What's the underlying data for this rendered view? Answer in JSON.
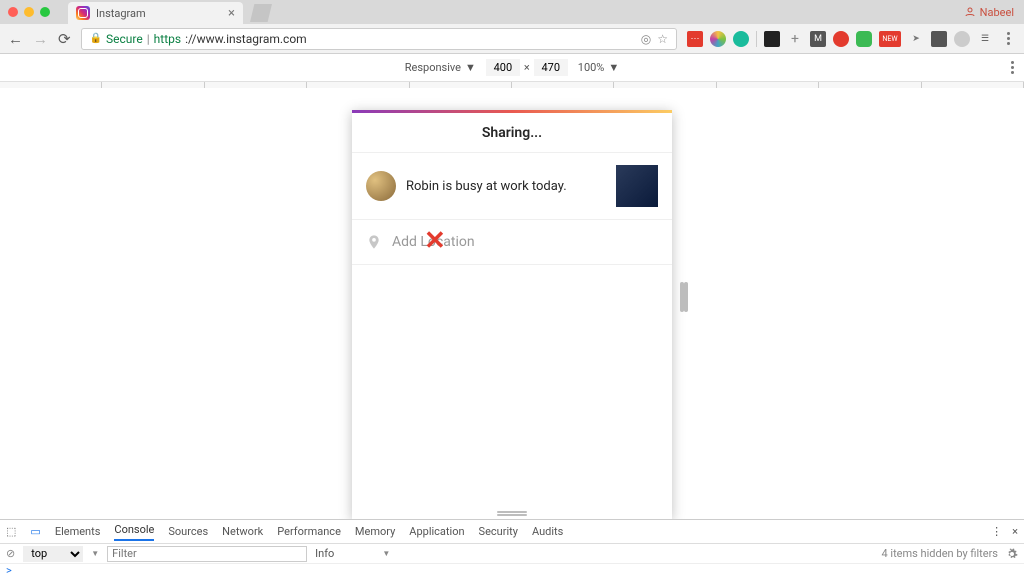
{
  "browser": {
    "profile_name": "Nabeel",
    "tab_title": "Instagram",
    "secure_label": "Secure",
    "url_proto": "https",
    "url_rest": "://www.instagram.com"
  },
  "device_bar": {
    "mode": "Responsive",
    "width": "400",
    "height": "470",
    "zoom": "100%"
  },
  "instagram": {
    "header": "Sharing...",
    "caption": "Robin is busy at work today.",
    "location_placeholder": "Add Location"
  },
  "devtools": {
    "tabs": {
      "elements": "Elements",
      "console": "Console",
      "sources": "Sources",
      "network": "Network",
      "performance": "Performance",
      "memory": "Memory",
      "application": "Application",
      "security": "Security",
      "audits": "Audits"
    },
    "context": "top",
    "filter_placeholder": "Filter",
    "level": "Info",
    "hidden_msg": "4 items hidden by filters",
    "prompt": ">"
  }
}
